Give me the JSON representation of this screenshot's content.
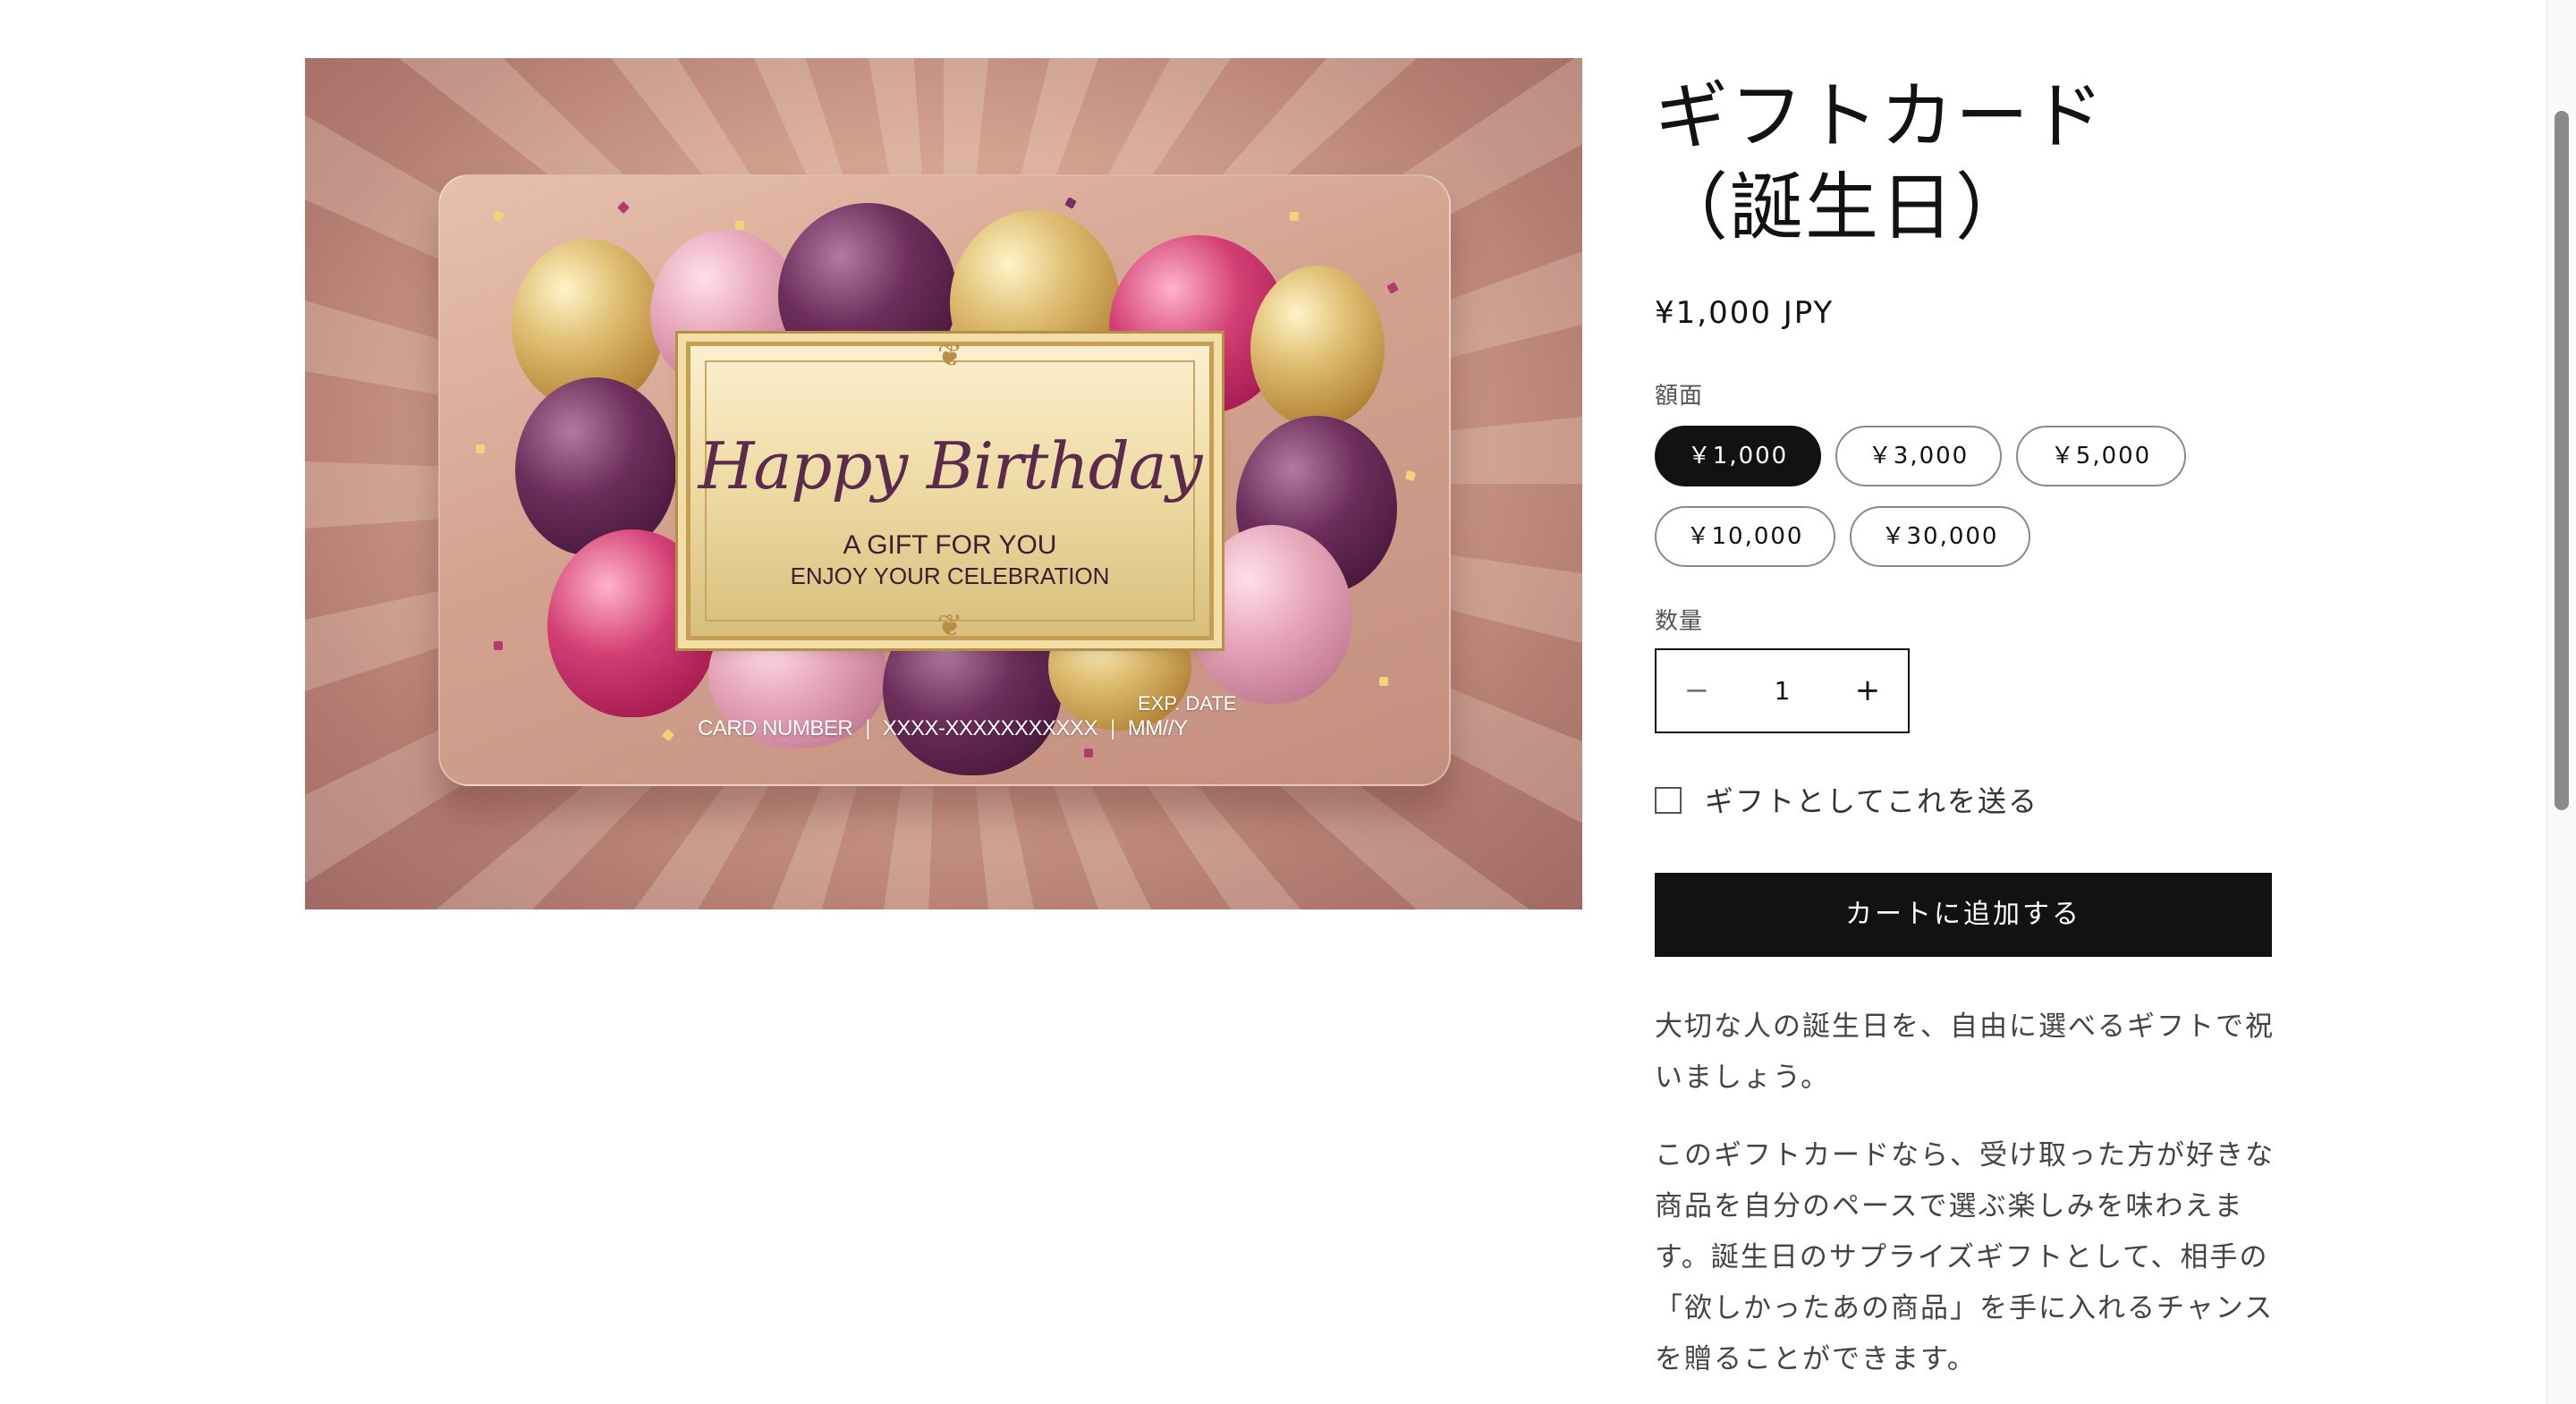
{
  "product": {
    "title": "ギフトカード（誕生日）",
    "price": "¥1,000 JPY",
    "image": {
      "card_title": "Happy Birthday",
      "card_subtitle": "A GIFT FOR YOU",
      "card_tagline": "ENJOY YOUR CELEBRATION",
      "card_number_label": "CARD NUMBER",
      "card_number": "XXXX-XXXXXXXXXXX",
      "exp_label": "EXP. DATE",
      "exp_value": "MM//Y"
    }
  },
  "denomination": {
    "label": "額面",
    "options": [
      "￥1,000",
      "￥3,000",
      "￥5,000",
      "￥10,000",
      "￥30,000"
    ],
    "selected": "￥1,000"
  },
  "quantity": {
    "label": "数量",
    "value": "1",
    "minus": "−",
    "plus": "+"
  },
  "gift": {
    "label": "ギフトとしてこれを送る",
    "checked": false
  },
  "add_to_cart": "カートに追加する",
  "description": [
    "大切な人の誕生日を、自由に選べるギフトで祝いましょう。",
    "このギフトカードなら、受け取った方が好きな商品を自分のペースで選ぶ楽しみを味わえます。誕生日のサプライズギフトとして、相手の「欲しかったあの商品」を手に入れるチャンスを贈ることができます。"
  ],
  "colors": {
    "primary": "#121212",
    "background": "#ffffff",
    "text_muted": "#555555",
    "border": "#8a8a8a"
  }
}
